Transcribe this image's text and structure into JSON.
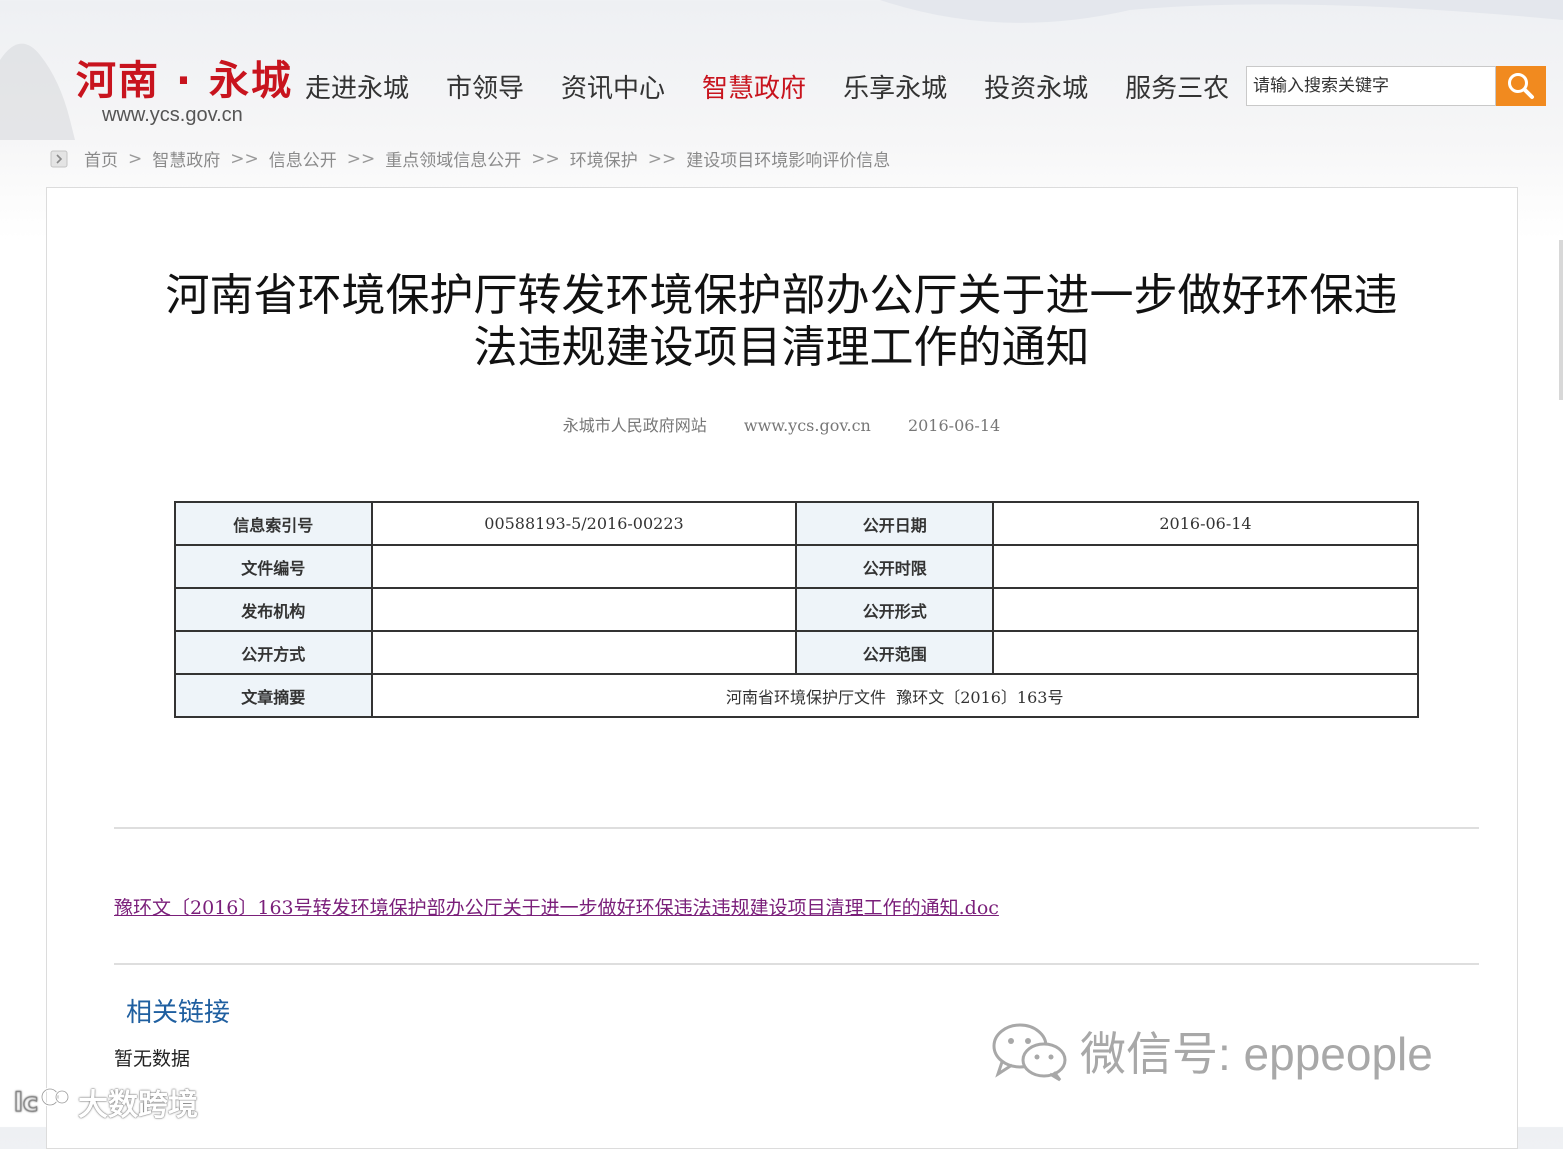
{
  "header": {
    "logo_title": "河南 · 永城",
    "logo_url": "www.ycs.gov.cn",
    "nav": [
      {
        "label": "走进永城",
        "active": false
      },
      {
        "label": "市领导",
        "active": false
      },
      {
        "label": "资讯中心",
        "active": false
      },
      {
        "label": "智慧政府",
        "active": true
      },
      {
        "label": "乐享永城",
        "active": false
      },
      {
        "label": "投资永城",
        "active": false
      },
      {
        "label": "服务三农",
        "active": false
      }
    ],
    "search": {
      "placeholder": "请输入搜索关键字",
      "button_icon": "search-icon"
    },
    "accent_color": "#c8141e",
    "search_button_color": "#f18a1f"
  },
  "breadcrumb": {
    "items": [
      "首页",
      "智慧政府",
      "信息公开",
      "重点领域信息公开",
      "环境保护",
      "建设项目环境影响评价信息"
    ],
    "separators": [
      ">",
      ">>",
      ">>",
      ">>",
      ">>"
    ]
  },
  "article": {
    "title_line1": "河南省环境保护厅转发环境保护部办公厅关于进一步做好环保违",
    "title_line2": "法违规建设项目清理工作的通知",
    "source": "永城市人民政府网站",
    "site": "www.ycs.gov.cn",
    "date": "2016-06-14"
  },
  "info_table": {
    "index_label": "信息索引号",
    "index_value": "00588193-5/2016-00223",
    "pub_date_label": "公开日期",
    "pub_date_value": "2016-06-14",
    "doc_no_label": "文件编号",
    "doc_no_value": "",
    "time_limit_label": "公开时限",
    "time_limit_value": "",
    "issuer_label": "发布机构",
    "issuer_value": "",
    "form_label": "公开形式",
    "form_value": "",
    "method_label": "公开方式",
    "method_value": "",
    "scope_label": "公开范围",
    "scope_value": "",
    "summary_label": "文章摘要",
    "summary_value": "河南省环境保护厅文件  豫环文〔2016〕163号"
  },
  "attachment": {
    "link_text": "豫环文〔2016〕163号转发环境保护部办公厅关于进一步做好环保违法违规建设项目清理工作的通知.doc"
  },
  "related": {
    "title": "相关链接",
    "empty_text": "暂无数据"
  },
  "watermarks": {
    "wechat": "微信号: eppeople",
    "brand": "大数跨境"
  }
}
